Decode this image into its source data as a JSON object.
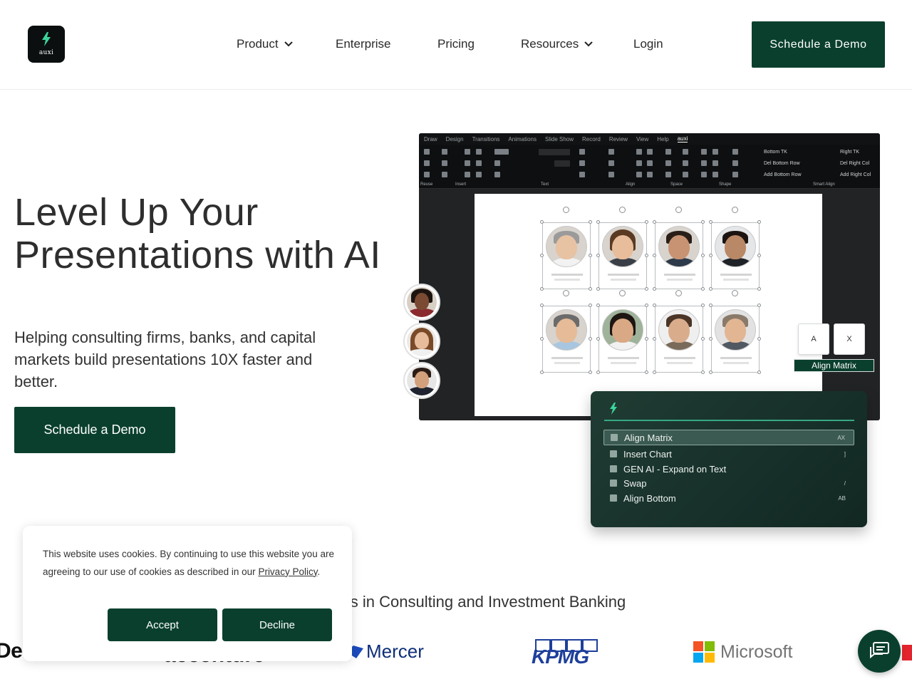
{
  "header": {
    "logo_text": "auxi",
    "nav": {
      "product": "Product",
      "enterprise": "Enterprise",
      "pricing": "Pricing",
      "resources": "Resources",
      "login": "Login"
    },
    "cta": "Schedule a Demo"
  },
  "hero": {
    "title": "Level Up Your Presentations with AI",
    "subtitle": "Helping consulting firms, banks, and capital markets build presentations 10X faster and better.",
    "cta": "Schedule a Demo"
  },
  "app_mockup": {
    "menu": [
      "Draw",
      "Design",
      "Transitions",
      "Animations",
      "Slide Show",
      "Record",
      "Review",
      "View",
      "Help",
      "auxi"
    ],
    "ribbon_groups": [
      "Reuse",
      "Insert",
      "Text",
      "Align",
      "Space",
      "Shape",
      "Smart Align"
    ],
    "smart_align": [
      "Bottom TK",
      "Right TK",
      "Del Bottom Row",
      "Del Right Col",
      "Add Bottom Row",
      "Add Right Col"
    ],
    "keycaps": [
      "A",
      "X"
    ],
    "align_label": "Align Matrix"
  },
  "palette": {
    "items": [
      {
        "label": "Align Matrix",
        "shortcut": "AX"
      },
      {
        "label": "Insert Chart",
        "shortcut": "]"
      },
      {
        "label": "GEN AI - Expand on Text",
        "shortcut": ""
      },
      {
        "label": "Swap",
        "shortcut": "/"
      },
      {
        "label": "Align Bottom",
        "shortcut": "AB"
      }
    ]
  },
  "trusted": {
    "text": "ders in Consulting and Investment Banking"
  },
  "logos": {
    "deloitte": "Del",
    "accenture": "accenture",
    "mercer": "Mercer",
    "kpmg": "KPMG",
    "microsoft": "Microsoft"
  },
  "cookie": {
    "text": "This website uses cookies. By continuing to use this website you are agreeing to our use of cookies as described in our ",
    "link": "Privacy Policy",
    "end": ".",
    "accept": "Accept",
    "decline": "Decline"
  },
  "colors": {
    "brand": "#0a3f2e",
    "accent": "#37a884"
  },
  "icons": {
    "logo": "bolt-icon",
    "chat": "chat-icon",
    "chevron": "chevron-down-icon"
  }
}
